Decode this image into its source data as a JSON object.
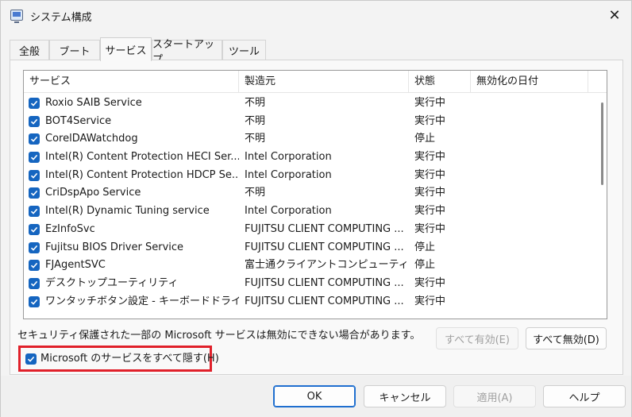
{
  "window": {
    "title": "システム構成",
    "close_label": "✕"
  },
  "tabs": [
    {
      "label": "全般",
      "active": false
    },
    {
      "label": "ブート",
      "active": false
    },
    {
      "label": "サービス",
      "active": true
    },
    {
      "label": "スタートアップ",
      "active": false
    },
    {
      "label": "ツール",
      "active": false
    }
  ],
  "list": {
    "columns": [
      "サービス",
      "製造元",
      "状態",
      "無効化の日付"
    ],
    "rows": [
      {
        "checked": true,
        "name": "Roxio SAIB Service",
        "maker": "不明",
        "status": "実行中",
        "date": ""
      },
      {
        "checked": true,
        "name": "BOT4Service",
        "maker": "不明",
        "status": "実行中",
        "date": ""
      },
      {
        "checked": true,
        "name": "CorelDAWatchdog",
        "maker": "不明",
        "status": "停止",
        "date": ""
      },
      {
        "checked": true,
        "name": "Intel(R) Content Protection HECI Ser...",
        "maker": "Intel Corporation",
        "status": "実行中",
        "date": ""
      },
      {
        "checked": true,
        "name": "Intel(R) Content Protection HDCP Se...",
        "maker": "Intel Corporation",
        "status": "実行中",
        "date": ""
      },
      {
        "checked": true,
        "name": "CriDspApo Service",
        "maker": "不明",
        "status": "実行中",
        "date": ""
      },
      {
        "checked": true,
        "name": "Intel(R) Dynamic Tuning service",
        "maker": "Intel Corporation",
        "status": "実行中",
        "date": ""
      },
      {
        "checked": true,
        "name": "EzInfoSvc",
        "maker": "FUJITSU CLIENT COMPUTING ...",
        "status": "実行中",
        "date": ""
      },
      {
        "checked": true,
        "name": "Fujitsu BIOS Driver Service",
        "maker": "FUJITSU CLIENT COMPUTING ...",
        "status": "停止",
        "date": ""
      },
      {
        "checked": true,
        "name": "FJAgentSVC",
        "maker": "富士通クライアントコンピューティン...",
        "status": "停止",
        "date": ""
      },
      {
        "checked": true,
        "name": "デスクトップユーティリティ",
        "maker": "FUJITSU CLIENT COMPUTING ...",
        "status": "実行中",
        "date": ""
      },
      {
        "checked": true,
        "name": "ワンタッチボタン設定 - キーボードドライバー...",
        "maker": "FUJITSU CLIENT COMPUTING ...",
        "status": "実行中",
        "date": ""
      }
    ]
  },
  "note": "セキュリティ保護された一部の Microsoft サービスは無効にできない場合があります。",
  "buttons": {
    "enable_all": "すべて有効(E)",
    "disable_all": "すべて無効(D)",
    "ok": "OK",
    "cancel": "キャンセル",
    "apply": "適用(A)",
    "help": "ヘルプ"
  },
  "hide_ms": {
    "checked": true,
    "label": "Microsoft のサービスをすべて隠す(H)"
  },
  "colors": {
    "checkbox": "#1565c0",
    "highlight_border": "#e0202a",
    "ok_border": "#1f6fcf"
  }
}
